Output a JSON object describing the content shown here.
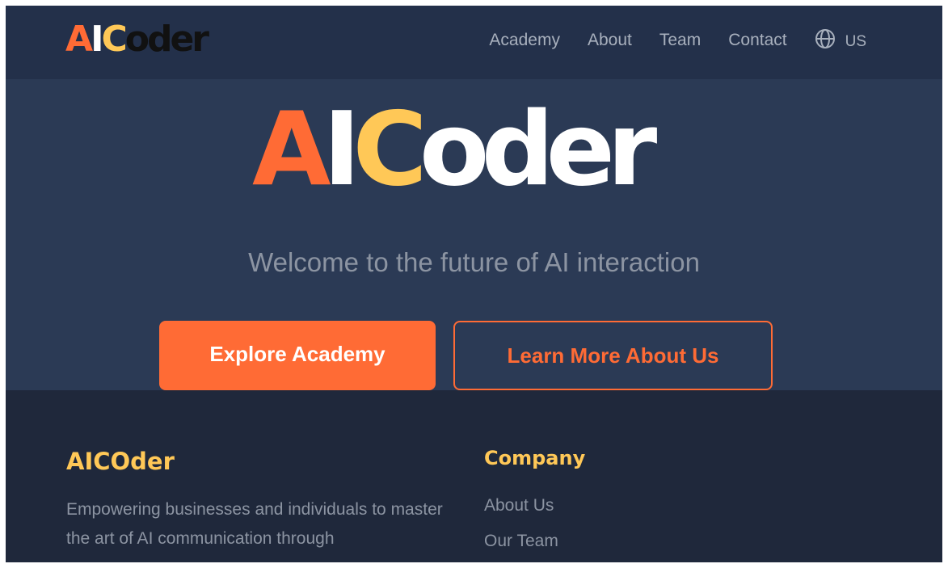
{
  "header": {
    "logo": {
      "part_a": "A",
      "part_i": "I",
      "part_c": "C",
      "part_oder": "oder"
    },
    "nav": [
      {
        "label": "Academy"
      },
      {
        "label": "About"
      },
      {
        "label": "Team"
      },
      {
        "label": "Contact"
      }
    ],
    "language": {
      "icon": "globe-icon",
      "label": "US"
    }
  },
  "hero": {
    "logo": {
      "part_a": "A",
      "part_i": "I",
      "part_c": "C",
      "part_oder": "oder"
    },
    "tagline": "Welcome to the future of AI interaction",
    "primary_button": "Explore Academy",
    "secondary_button": "Learn More About Us"
  },
  "footer": {
    "brand": "AICOder",
    "description": "Empowering businesses and individuals to master the art of AI communication through",
    "company": {
      "title": "Company",
      "links": [
        {
          "label": "About Us"
        },
        {
          "label": "Our Team"
        }
      ]
    }
  },
  "colors": {
    "accent_orange": "#ff6b35",
    "accent_yellow": "#ffc857",
    "header_bg": "#23304a",
    "hero_bg": "#2b3a55",
    "footer_bg": "#1f283b"
  }
}
